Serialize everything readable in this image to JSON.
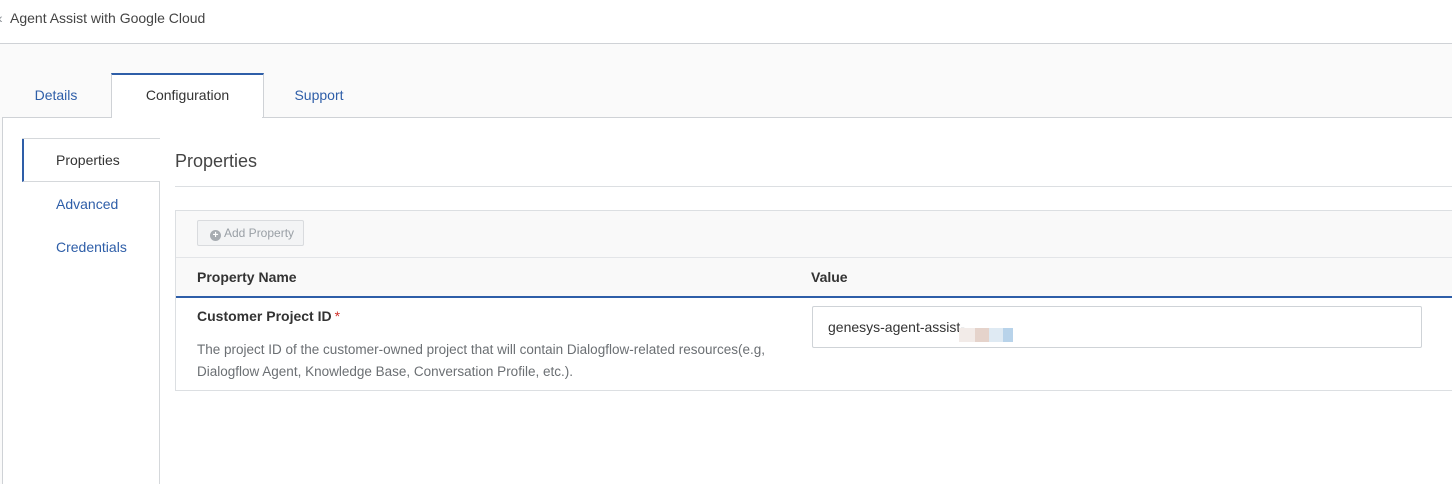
{
  "header": {
    "title": "Agent Assist with Google Cloud"
  },
  "tabs": [
    {
      "label": "Details",
      "active": false
    },
    {
      "label": "Configuration",
      "active": true
    },
    {
      "label": "Support",
      "active": false
    }
  ],
  "side_nav": [
    {
      "label": "Properties",
      "active": true
    },
    {
      "label": "Advanced",
      "active": false
    },
    {
      "label": "Credentials",
      "active": false
    }
  ],
  "content": {
    "title": "Properties",
    "add_button_label": "Add Property",
    "columns": {
      "name": "Property Name",
      "value": "Value"
    },
    "rows": [
      {
        "name": "Customer Project ID",
        "required_marker": "*",
        "description": "The project ID of the customer-owned project that will contain Dialogflow-related resources(e.g, Dialogflow Agent, Knowledge Base, Conversation Profile, etc.).",
        "value": "genesys-agent-assist-"
      }
    ]
  },
  "colors": {
    "accent": "#2e5ea8",
    "required": "#d0302a"
  }
}
